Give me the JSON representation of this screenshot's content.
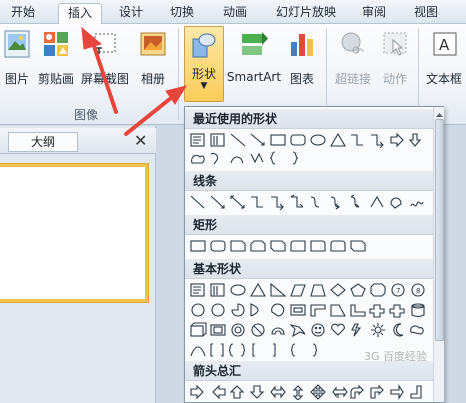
{
  "tabs": [
    {
      "label": "开始",
      "active": false
    },
    {
      "label": "插入",
      "active": true
    },
    {
      "label": "设计",
      "active": false
    },
    {
      "label": "切换",
      "active": false
    },
    {
      "label": "动画",
      "active": false
    },
    {
      "label": "幻灯片放映",
      "active": false
    },
    {
      "label": "审阅",
      "active": false
    },
    {
      "label": "视图",
      "active": false
    }
  ],
  "ribbon": {
    "picture_label": "图片",
    "clipart_label": "剪贴画",
    "screenshot_label": "屏幕截图",
    "album_label": "相册",
    "shapes_label": "形状",
    "smartart_label": "SmartArt",
    "chart_label": "图表",
    "hyperlink_label": "超链接",
    "action_label": "动作",
    "textbox_label": "文本框",
    "images_group_label": "图像"
  },
  "left_pane": {
    "tab_label": "大纲",
    "close_glyph": "✕"
  },
  "shapes_menu": {
    "sections": [
      {
        "title": "最近使用的形状"
      },
      {
        "title": "线条"
      },
      {
        "title": "矩形"
      },
      {
        "title": "基本形状"
      },
      {
        "title": "箭头总汇"
      }
    ],
    "basic_numbers": [
      "10",
      "12"
    ]
  },
  "annotation_color": "#e8453c",
  "accent_color": "#f3c24a",
  "watermark_text": "3G 百度经验"
}
